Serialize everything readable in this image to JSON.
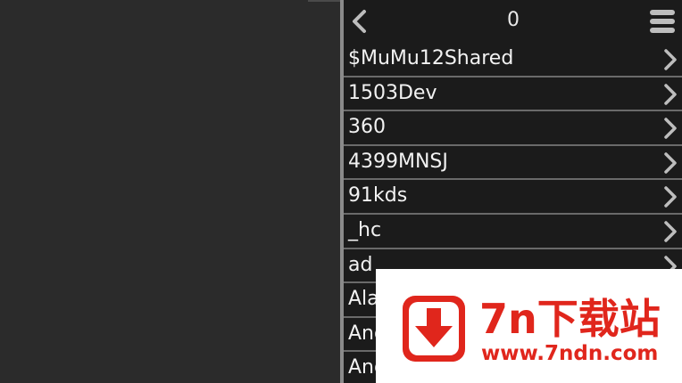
{
  "header": {
    "count": "0",
    "back_icon": "chevron-left-icon",
    "menu_icon": "menu-icon"
  },
  "list": {
    "items": [
      {
        "label": "$MuMu12Shared"
      },
      {
        "label": "1503Dev"
      },
      {
        "label": "360"
      },
      {
        "label": "4399MNSJ"
      },
      {
        "label": "91kds"
      },
      {
        "label": "_hc"
      },
      {
        "label": "ad"
      },
      {
        "label": "Ala"
      },
      {
        "label": "And"
      },
      {
        "label": "And"
      }
    ],
    "chevron_icon": "chevron-right-icon"
  },
  "watermark": {
    "title": "7n下载站",
    "url": "www.7ndn.com",
    "logo_icon": "download-arrow-icon",
    "color": "#e0261c"
  }
}
